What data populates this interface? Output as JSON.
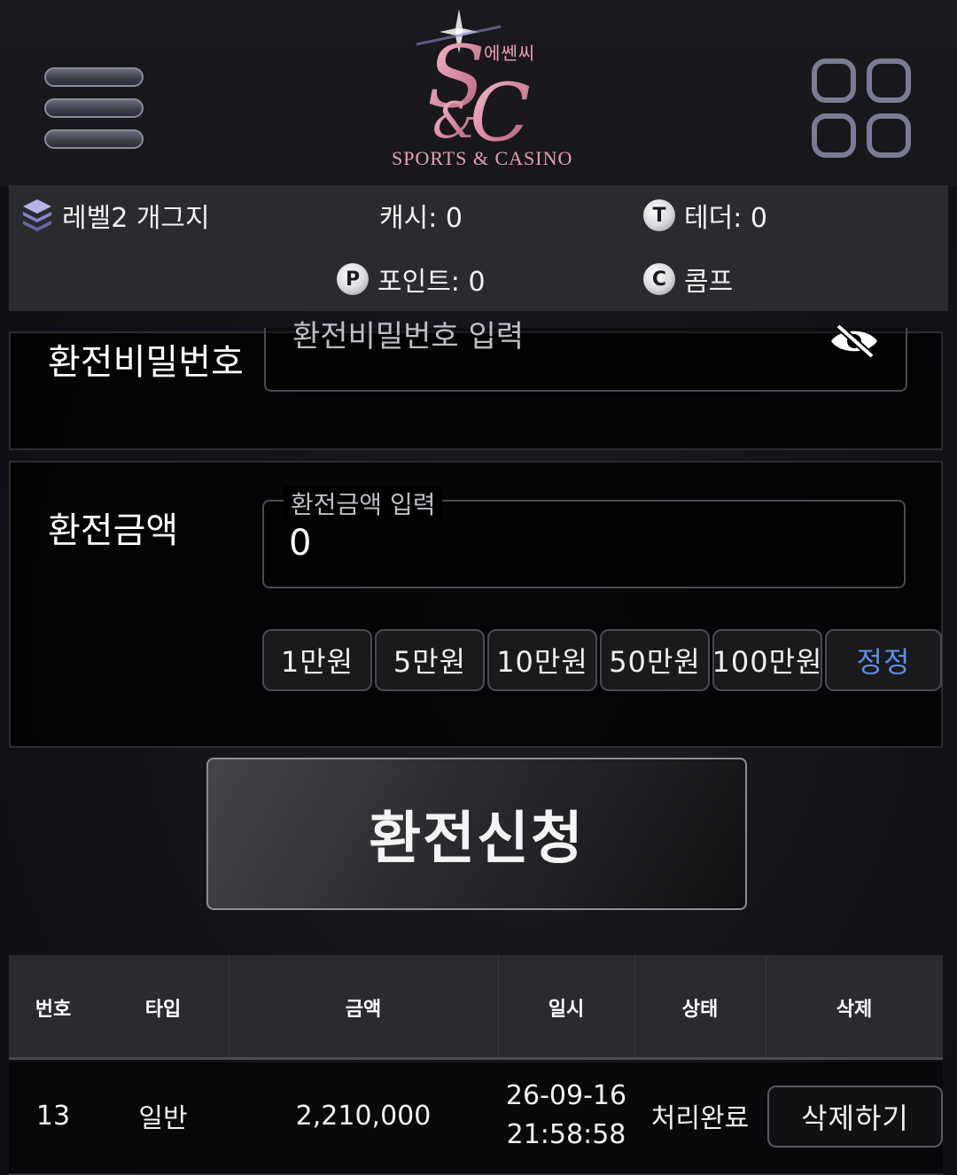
{
  "header": {
    "logo": {
      "main": "S&C",
      "korean": "에쎈씨",
      "sub": "SPORTS & CASINO"
    },
    "menu_icon": "hamburger-icon",
    "apps_icon": "grid-icon"
  },
  "status": {
    "level": "레벨2 개그지",
    "cash": "캐시: 0",
    "tether": "테더: 0",
    "point": "포인트: 0",
    "comp": "콤프",
    "icons": {
      "tether": "T",
      "point": "P",
      "comp": "C"
    }
  },
  "password_section": {
    "label": "환전비밀번호",
    "placeholder": "환전비밀번호 입력"
  },
  "amount_section": {
    "label": "환전금액",
    "input_legend": "환전금액 입력",
    "input_value": "0",
    "quick_buttons": [
      "1만원",
      "5만원",
      "10만원",
      "50만원",
      "100만원"
    ],
    "reset_label": "정정"
  },
  "apply_button": "환전신청",
  "table": {
    "headers": [
      "번호",
      "타입",
      "금액",
      "일시",
      "상태",
      "삭제"
    ],
    "rows": [
      {
        "no": "13",
        "type": "일반",
        "amount": "2,210,000",
        "date": "26-09-16",
        "time": "21:58:58",
        "status": "처리완료",
        "delete_label": "삭제하기"
      }
    ]
  },
  "colors": {
    "accent_pink": "#e8a0b4",
    "reset_blue": "#5b8ee6",
    "status_bar": "#2a2b2e"
  }
}
